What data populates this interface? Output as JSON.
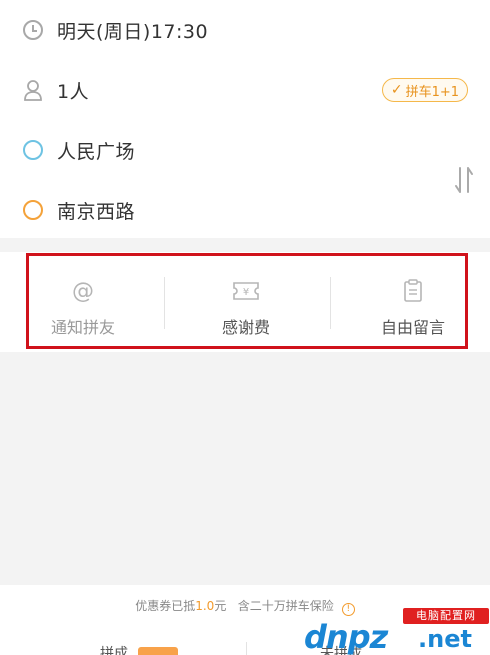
{
  "trip": {
    "time": "明天(周日)17:30",
    "passengers": "1人",
    "carpool_badge": "拼车1+1",
    "start": "人民广场",
    "end": "南京西路"
  },
  "actions": [
    {
      "label": "通知拼友",
      "icon": "at-icon"
    },
    {
      "label": "感谢费",
      "icon": "ticket-yen-icon",
      "icon_text": "¥"
    },
    {
      "label": "自由留言",
      "icon": "clipboard-icon"
    }
  ],
  "footer": {
    "coupon_prefix": "优惠券已抵",
    "coupon_amount": "1.0",
    "coupon_suffix": "元",
    "insurance": "含二十万拼车保险",
    "left_button": "拼成",
    "right_button": "未拼成"
  },
  "watermark": {
    "site_name": "电脑配置网",
    "logo": "dnpz",
    "domain": ".net"
  },
  "colors": {
    "start_dot": "#6ec3e3",
    "end_dot": "#f4a23a",
    "badge": "#e8931e",
    "highlight_box": "#d0121b"
  }
}
